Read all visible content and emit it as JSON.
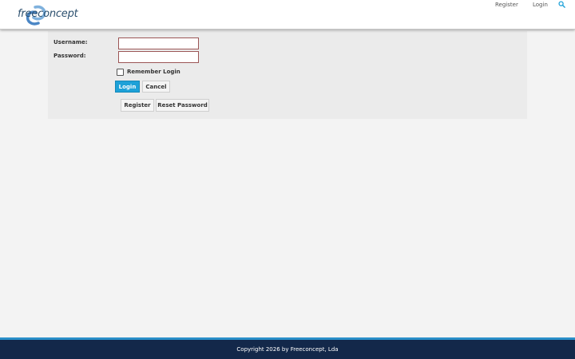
{
  "header": {
    "logo_text": "freeconcept",
    "nav": {
      "register": "Register",
      "login": "Login"
    },
    "search_icon": "search-icon"
  },
  "login_form": {
    "username_label": "Username:",
    "username_value": "",
    "password_label": "Password:",
    "password_value": "",
    "remember_label": "Remember Login",
    "remember_checked": false,
    "login_button": "Login",
    "cancel_button": "Cancel",
    "register_button": "Register",
    "reset_password_button": "Reset Password"
  },
  "footer": {
    "copyright": "Copyright 2026 by Freeconcept, Lda"
  },
  "colors": {
    "accent": "#1da1d8",
    "footer_bg": "#13284a",
    "footer_line": "#2a8fc9",
    "page_bg": "#f3f3f3",
    "panel_bg": "#ebebeb"
  }
}
